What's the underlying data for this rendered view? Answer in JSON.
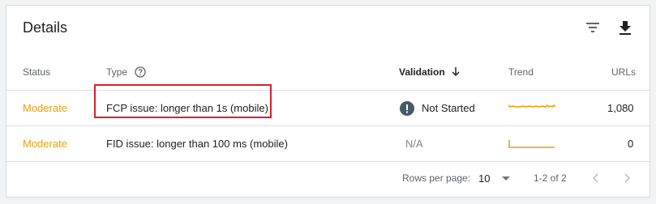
{
  "card": {
    "title": "Details",
    "toolbar": {
      "filter_icon": "filter-icon",
      "download_icon": "download-icon"
    }
  },
  "table": {
    "columns": {
      "status": "Status",
      "type": "Type",
      "validation": "Validation",
      "trend": "Trend",
      "urls": "URLs"
    },
    "help_icon": "help-circle-icon",
    "sort_icon": "arrow-down-icon",
    "rows": [
      {
        "status": "Moderate",
        "type": "FCP issue: longer than 1s (mobile)",
        "validation": "Not Started",
        "validation_icon": "exclamation-icon",
        "urls": "1,080"
      },
      {
        "status": "Moderate",
        "type": "FID issue: longer than 100 ms (mobile)",
        "validation": "N/A",
        "urls": "0"
      }
    ]
  },
  "pagination": {
    "rows_per_page_label": "Rows per page:",
    "rows_per_page_value": "10",
    "range": "1-2 of 2"
  },
  "colors": {
    "status_moderate": "#e8a00e",
    "trend_line": "#f29900",
    "highlight_border": "#d9202b"
  }
}
